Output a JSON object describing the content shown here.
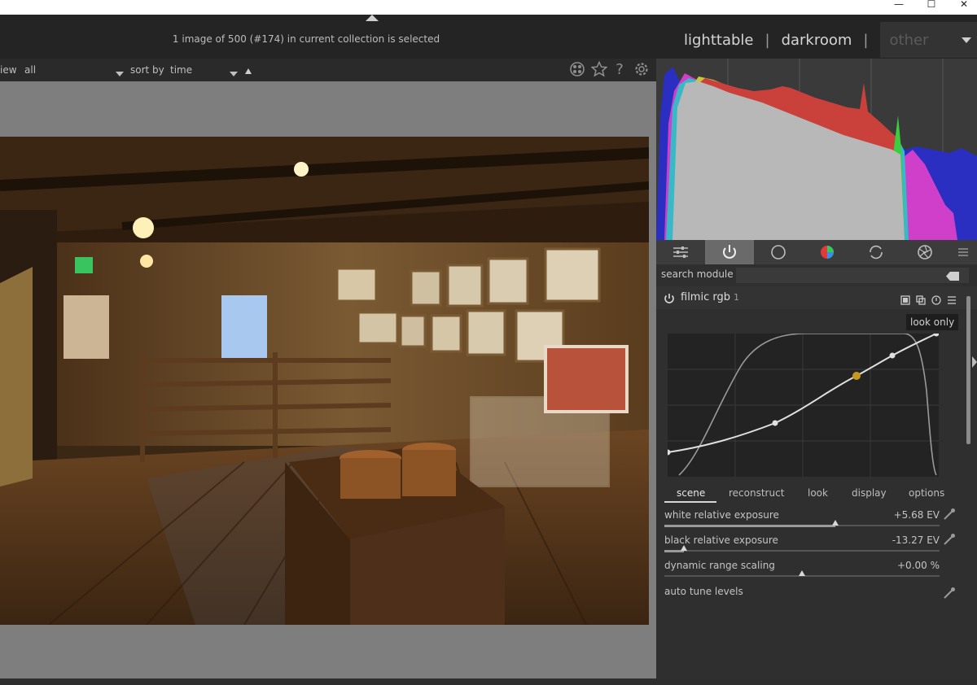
{
  "window": {
    "minimize_glyph": "—",
    "maximize_glyph": "☐",
    "close_glyph": "✕"
  },
  "header": {
    "status": "1 image of 500 (#174) in current collection is selected",
    "views": [
      "lighttable",
      "darkroom",
      "other"
    ],
    "separator": "|"
  },
  "filterbar": {
    "view_label": "iew",
    "view_value": "all",
    "sort_label": "sort by",
    "sort_value": "time",
    "help_glyph": "?"
  },
  "right_panel": {
    "search_label": "search module",
    "module": {
      "name": "filmic rgb",
      "instance": "1",
      "look_only_label": "look only"
    },
    "tabs": [
      "scene",
      "reconstruct",
      "look",
      "display",
      "options"
    ],
    "active_tab": "scene",
    "sliders": [
      {
        "name": "white relative exposure",
        "value": "+5.68 EV",
        "position": 0.62
      },
      {
        "name": "black relative exposure",
        "value": "-13.27 EV",
        "position": 0.07
      },
      {
        "name": "dynamic range scaling",
        "value": "+0.00 %",
        "position": 0.5
      }
    ],
    "auto_tune_label": "auto tune levels"
  },
  "colors": {
    "accent_node": "#c9961c",
    "app_bg": "#2b2b2b",
    "center_bg": "#7e7e7e"
  }
}
